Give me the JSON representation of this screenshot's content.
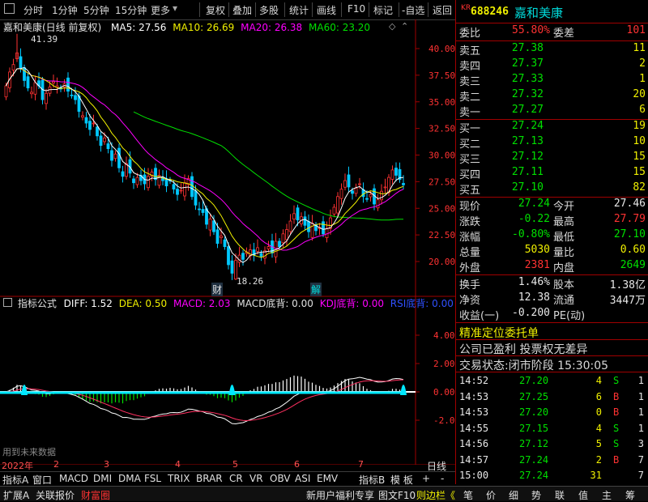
{
  "toolbar": {
    "items": [
      "分时",
      "1分钟",
      "5分钟",
      "15分钟",
      "更多",
      "复权",
      "叠加",
      "多股",
      "统计",
      "画线",
      "F10",
      "标记",
      "-自选",
      "返回"
    ]
  },
  "stock": {
    "market": "KR",
    "code": "688246",
    "name": "嘉和美康"
  },
  "chart_title": "嘉和美康(日线 前复权)",
  "ma": {
    "ma5": "MA5: 27.56",
    "ma10": "MA10: 26.69",
    "ma20": "MA20: 26.38",
    "ma60": "MA60: 23.20"
  },
  "annot": {
    "high": "41.39",
    "low": "18.26",
    "cai": "财",
    "jie": "解"
  },
  "price_axis": [
    "40.00",
    "37.50",
    "35.00",
    "32.50",
    "30.00",
    "27.50",
    "25.00",
    "22.50",
    "20.00"
  ],
  "ind": {
    "name": "指标公式",
    "diff": "DIFF: 1.52",
    "dea": "DEA: 0.50",
    "macd": "MACD: 2.03",
    "macddb": "MACD底背: 0.00",
    "kdjdb": "KDJ底背: 0.00",
    "rsidb": "RSI底背: 0.00",
    "note": "用到未来数据"
  },
  "ind_axis": [
    "4.00",
    "2.00",
    "0.00",
    "-2.00"
  ],
  "time_axis": [
    "2022年",
    "2",
    "3",
    "4",
    "5",
    "6",
    "7"
  ],
  "tabs": [
    "指标A",
    "窗口",
    "MACD",
    "DMI",
    "DMA",
    "FSL",
    "TRIX",
    "BRAR",
    "CR",
    "VR",
    "OBV",
    "ASI",
    "EMV"
  ],
  "tabs_right": [
    "指标B",
    "模 板",
    "+",
    "-"
  ],
  "rixian": "日线",
  "bottom_left": [
    "扩展A",
    "关联报价",
    "财富圈"
  ],
  "bottom_mid": [
    "新用户福利专享",
    "图文F10",
    "则边栏《"
  ],
  "bottom_right": [
    "笔",
    "价",
    "细",
    "势",
    "联",
    "值",
    "主",
    "筹"
  ],
  "panel": {
    "weibi_label": "委比",
    "weibi": "55.80%",
    "weicha_label": "委差",
    "weicha": "101",
    "asks": [
      {
        "l": "卖五",
        "p": "27.38",
        "v": "11"
      },
      {
        "l": "卖四",
        "p": "27.37",
        "v": "2"
      },
      {
        "l": "卖三",
        "p": "27.33",
        "v": "1"
      },
      {
        "l": "卖二",
        "p": "27.32",
        "v": "20"
      },
      {
        "l": "卖一",
        "p": "27.27",
        "v": "6"
      }
    ],
    "bids": [
      {
        "l": "买一",
        "p": "27.24",
        "v": "19"
      },
      {
        "l": "买二",
        "p": "27.13",
        "v": "10"
      },
      {
        "l": "买三",
        "p": "27.12",
        "v": "15"
      },
      {
        "l": "买四",
        "p": "27.11",
        "v": "15"
      },
      {
        "l": "买五",
        "p": "27.10",
        "v": "82"
      }
    ],
    "stats": [
      {
        "a": "现价",
        "av": "27.24",
        "ac": "green",
        "b": "今开",
        "bv": "27.46",
        "bc": "white"
      },
      {
        "a": "涨跌",
        "av": "-0.22",
        "ac": "green",
        "b": "最高",
        "bv": "27.79",
        "bc": "red"
      },
      {
        "a": "涨幅",
        "av": "-0.80%",
        "ac": "green",
        "b": "最低",
        "bv": "27.10",
        "bc": "green"
      },
      {
        "a": "总量",
        "av": "5030",
        "ac": "yellow",
        "b": "量比",
        "bv": "0.60",
        "bc": "yellow"
      },
      {
        "a": "外盘",
        "av": "2381",
        "ac": "red",
        "b": "内盘",
        "bv": "2649",
        "bc": "green"
      }
    ],
    "stats2": [
      {
        "a": "换手",
        "av": "1.46%",
        "b": "股本",
        "bv": "1.38亿"
      },
      {
        "a": "净资",
        "av": "12.38",
        "b": "流通",
        "bv": "3447万"
      },
      {
        "a": "收益(一)",
        "av": "-0.200",
        "b": "PE(动)",
        "bv": ""
      }
    ],
    "promo": "精准定位委托单",
    "note": "公司已盈利 投票权无差异",
    "status": "交易状态:闭市阶段 15:30:05",
    "ticks": [
      {
        "t": "14:52",
        "p": "27.20",
        "v": "4",
        "f": "S",
        "n": "1"
      },
      {
        "t": "14:53",
        "p": "27.25",
        "v": "6",
        "f": "B",
        "n": "1"
      },
      {
        "t": "14:53",
        "p": "27.20",
        "v": "0",
        "f": "B",
        "n": "1"
      },
      {
        "t": "14:55",
        "p": "27.15",
        "v": "4",
        "f": "S",
        "n": "1"
      },
      {
        "t": "14:56",
        "p": "27.12",
        "v": "5",
        "f": "S",
        "n": "3"
      },
      {
        "t": "14:57",
        "p": "27.24",
        "v": "2",
        "f": "B",
        "n": "7"
      },
      {
        "t": "15:00",
        "p": "27.24",
        "v": "31",
        "f": "",
        "n": "7"
      }
    ]
  },
  "colors": {
    "up": "#ff3232",
    "down": "#00e000",
    "ma5": "#ffffff",
    "ma10": "#f0f000",
    "ma20": "#ff00ff",
    "ma60": "#00e000",
    "panel_border": "#a00000"
  }
}
